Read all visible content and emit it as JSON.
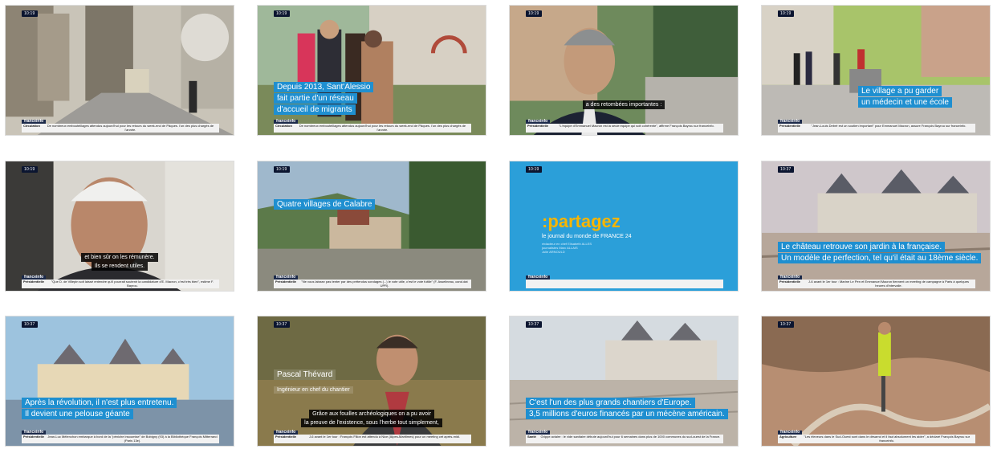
{
  "thumbnails": [
    {
      "time": "10:19",
      "caption": [],
      "speech": [],
      "ticker_cat": "Circulation",
      "ticker": "De nombreux embouteillages attendus aujourd'hui pour les retours du week-end de Pâques. l'un des plus chargés de l'année."
    },
    {
      "time": "10:19",
      "caption": [
        "Depuis 2013, Sant'Alessio",
        "fait partie d'un réseau",
        "d'accueil de migrants"
      ],
      "speech": [],
      "ticker_cat": "Circulation",
      "ticker": "De nombreux embouteillages attendus aujourd'hui pour les retours du week-end de Pâques. l'un des plus chargés de l'année."
    },
    {
      "time": "10:19",
      "caption": [],
      "speech": [
        "a des retombées importantes :"
      ],
      "ticker_cat": "Présidentielle",
      "ticker": "\"L'équipe d'Emmanuel Macron est la seule équipe qui soit cohérente\", affirme François Bayrou sur franceinfo."
    },
    {
      "time": "10:19",
      "caption": [
        "Le village a pu garder",
        "un médecin et une école"
      ],
      "speech": [],
      "ticker_cat": "Présidentielle",
      "ticker": "\"Jean-Louis Debré est un soutien important\" pour Emmanuel Macron, assure François Bayrou sur franceinfo."
    },
    {
      "time": "10:19",
      "caption": [],
      "speech": [
        "et bien sûr on les rémunère.",
        "Ils se rendent utiles."
      ],
      "ticker_cat": "Présidentielle",
      "ticker": "\"Que D. de Villepin soit laissé entendre qu'il pourrait soutenir la candidature d'E. Macron, c'est très bien\", estime F. Bayrou."
    },
    {
      "time": "10:19",
      "caption": [
        "Quatre villages de Calabre"
      ],
      "speech": [],
      "ticker_cat": "Présidentielle",
      "ticker": "\"Ne vous laissez pas tenter par des prétendus sondages (...) le vote utile, c'est le vote fuitile\" (F. Asselineau, cand.dat UPR)."
    },
    {
      "time": "10:19",
      "partagez": ":partagez",
      "partagez_sub": "le journal du monde de FRANCE 24",
      "partagez_meta": [
        "rédacteur en chef    Elisabeth ALLES",
        "journalistes           Marc ALLAIS",
        "                              Julie ARNOULD"
      ],
      "caption": [],
      "speech": [],
      "ticker_cat": "",
      "ticker": ""
    },
    {
      "time": "10:37",
      "caption": [
        "Le château retrouve son jardin à la française.",
        "Un modèle de perfection, tel qu'il était au 18ème siècle."
      ],
      "speech": [],
      "ticker_cat": "Présidentielle",
      "ticker": "J-6 avant le 1er tour : Marine Le Pen et Emmanuel Macron tiennent un meeting de campagne à Paris à quelques heures d'intervalle."
    },
    {
      "time": "10:37",
      "caption": [
        "Après la révolution, il n'est plus entretenu.",
        "Il devient une pelouse géante"
      ],
      "speech": [],
      "ticker_cat": "Présidentielle",
      "ticker": "Jean-Luc Mélenchon embarque à bord de la \"péniche insoumise\" de Bobigny (93) à la Bibliothèque François Mitterrand (Paris 13e)."
    },
    {
      "time": "10:37",
      "name": "Pascal Thévard",
      "role": "Ingénieur en chef du chantier",
      "caption": [],
      "speech": [
        "Grâce aux fouilles archéologiques on a pu avoir",
        "la preuve de l'existence, sous l'herbe tout simplement,"
      ],
      "ticker_cat": "Présidentielle",
      "ticker": "J-6 avant le 1er tour : François Fillon est attendu à Nice (Alpes-Maritimes) pour un meeting cet après-midi."
    },
    {
      "time": "10:37",
      "caption": [
        "C'est l'un des plus grands chantiers d'Europe.",
        "3,5 millions d'euros financés par un mécène américain."
      ],
      "speech": [],
      "ticker_cat": "Santé",
      "ticker": "Grippe aviaire : le vide sanitaire débute aujourd'hui pour 6 semaines dans plus de 1000 communes du sud-ouest de la France."
    },
    {
      "time": "10:37",
      "caption": [],
      "speech": [],
      "ticker_cat": "Agriculture",
      "ticker": "\"Les éleveurs dans le Sud-Ouest sont dans le désarroi et il faut absolument les aider\", a déclaré François Bayrou sur franceinfo."
    }
  ],
  "brand": "franceinfo",
  "colors": {
    "caption_bg": "#1f8fd0",
    "brand_bar": "#1c2a4a",
    "partagez_bg": "#2b9fd9",
    "partagez_accent": "#f7b500"
  }
}
